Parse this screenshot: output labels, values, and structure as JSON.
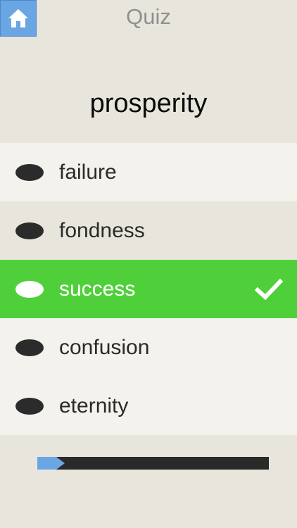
{
  "header": {
    "title": "Quiz",
    "home_icon": "home-icon"
  },
  "question": {
    "word": "prosperity"
  },
  "options": [
    {
      "label": "failure",
      "state": "default"
    },
    {
      "label": "fondness",
      "state": "default"
    },
    {
      "label": "success",
      "state": "correct"
    },
    {
      "label": "confusion",
      "state": "default"
    },
    {
      "label": "eternity",
      "state": "default"
    }
  ],
  "progress": {
    "fraction": 0.12
  },
  "colors": {
    "background": "#e8e6dc",
    "row_light": "#f3f2ec",
    "correct": "#4fd03a",
    "accent": "#6aa6e4",
    "track": "#2a2a2a"
  }
}
